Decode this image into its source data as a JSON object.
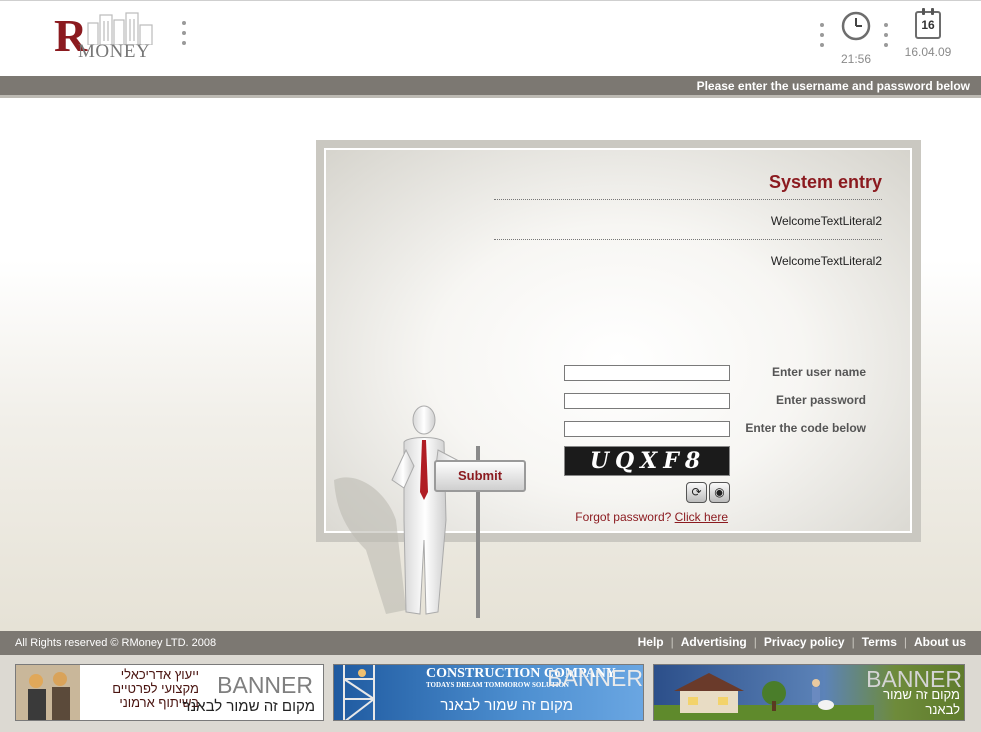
{
  "header": {
    "logo_r": "R",
    "logo_money": "MONEY",
    "time": "21:56",
    "calendar_day": "16",
    "date": "16.04.09"
  },
  "topbar": {
    "text": "Please enter the username and password below"
  },
  "login": {
    "title": "System entry",
    "welcome_1": "WelcomeTextLiteral2",
    "welcome_2": "WelcomeTextLiteral2",
    "username_label": "Enter user name",
    "password_label": "Enter password",
    "code_label": "Enter the code below",
    "username_value": "",
    "password_value": "",
    "code_value": "",
    "captcha_text": "UQXF8",
    "refresh_glyph": "⟳",
    "audio_glyph": "◉",
    "forgot_text": "Forgot password?",
    "forgot_link": "Click here",
    "submit_label": "Submit"
  },
  "footer": {
    "copyright": "All Rights reserved © RMoney LTD. 2008",
    "links": [
      "Help",
      "Advertising",
      "Privacy policy",
      "Terms",
      "About us"
    ],
    "separator": "|"
  },
  "banners": [
    {
      "word": "BANNER",
      "text": "מקום זה שמור לבאנר",
      "extra_lines": [
        "ייעוץ אדריכאלי",
        "מקצועי לפרטיים",
        "בשיתוף ארמוני"
      ]
    },
    {
      "word": "BANNER",
      "text": "מקום זה שמור לבאנר",
      "company": "CONSTRUCTION COMPANY",
      "slogan": "TODAYS DREAM TOMMOROW SOLUTION"
    },
    {
      "word": "BANNER",
      "text_line_1": "מקום זה שמור",
      "text_line_2": "לבאנר"
    }
  ],
  "colors": {
    "brand": "#8b1a1f",
    "bar": "#7c7872"
  }
}
